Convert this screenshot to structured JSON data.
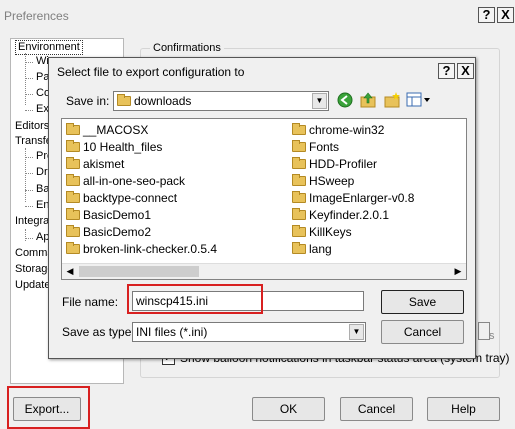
{
  "window": {
    "title": "Preferences",
    "help_glyph": "?",
    "close_glyph": "X"
  },
  "tree": {
    "items": [
      {
        "label": "Environment",
        "indent": 0
      },
      {
        "label": "Wir",
        "indent": 1
      },
      {
        "label": "Par",
        "indent": 1
      },
      {
        "label": "Cor",
        "indent": 1
      },
      {
        "label": "Exp",
        "indent": 1
      },
      {
        "label": "Editors",
        "indent": 0
      },
      {
        "label": "Transfer",
        "indent": 0
      },
      {
        "label": "Pre",
        "indent": 1
      },
      {
        "label": "Dra",
        "indent": 1
      },
      {
        "label": "Bac",
        "indent": 1
      },
      {
        "label": "End",
        "indent": 1
      },
      {
        "label": "Integrat",
        "indent": 0
      },
      {
        "label": "App",
        "indent": 1
      },
      {
        "label": "Comma",
        "indent": 0
      },
      {
        "label": "Storage",
        "indent": 0
      },
      {
        "label": "Update",
        "indent": 0
      }
    ]
  },
  "confirmations": {
    "group_label": "Confirmations",
    "balloon_checkbox_label": "Show balloon notifications in taskbar status area (system tray)",
    "balloon_checked": true,
    "checkmark": "✓",
    "partial_text": "s"
  },
  "footer": {
    "export_label": "Export...",
    "ok_label": "OK",
    "cancel_label": "Cancel",
    "help_label": "Help"
  },
  "dialog": {
    "title": "Select file to export configuration to",
    "help_glyph": "?",
    "close_glyph": "X",
    "save_in_label": "Save in:",
    "save_in_value": "downloads",
    "files_left": [
      "__MACOSX",
      "10 Health_files",
      "akismet",
      "all-in-one-seo-pack",
      "backtype-connect",
      "BasicDemo1",
      "BasicDemo2",
      "broken-link-checker.0.5.4"
    ],
    "files_right": [
      "chrome-win32",
      "Fonts",
      "HDD-Profiler",
      "HSweep",
      "ImageEnlarger-v0.8",
      "Keyfinder.2.0.1",
      "KillKeys",
      "lang"
    ],
    "file_name_label": "File name:",
    "file_name_value": "winscp415.ini",
    "save_as_type_label": "Save as type:",
    "save_as_type_value": "INI files (*.ini)",
    "save_label": "Save",
    "cancel_label": "Cancel"
  }
}
